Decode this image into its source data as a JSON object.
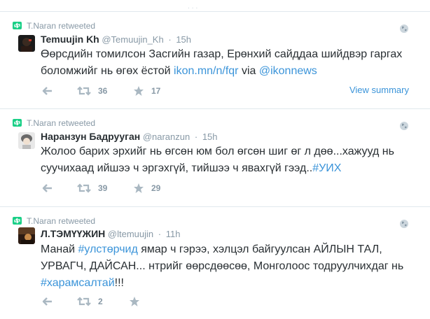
{
  "tweets": [
    {
      "retweeted_by": "T.Naran retweeted",
      "name": "Temuujin Kh",
      "handle": "@Temuujin_Kh",
      "dot": "·",
      "time": "15h",
      "text_parts": [
        "Өөрсдийн томилсон Засгийн газар, Ерөнхий сайддаа шийдвэр гаргах боломжийг нь өгөх ёстой ",
        "ikon.mn/n/fqr",
        " via ",
        "@ikonnews"
      ],
      "retweet_count": "36",
      "favorite_count": "17",
      "view_summary": "View summary",
      "avatar_colors": [
        "#1a1a1a",
        "#3a2a20",
        "#c0392b"
      ]
    },
    {
      "retweeted_by": "T.Naran retweeted",
      "name": "Наранзун Бадрууган",
      "handle": "@naranzun",
      "dot": "·",
      "time": "15h",
      "text_parts": [
        "Жолоо барих эрхийг нь өгсөн юм бол өгсөн шиг өг л дөө...хажууд нь суучихаад ийшээ ч эргэхгүй, тийшээ ч явахгүй гээд..",
        "#УИХ"
      ],
      "retweet_count": "39",
      "favorite_count": "29",
      "avatar_colors": [
        "#d8d8d8",
        "#8a8a8a",
        "#f0e0d0"
      ]
    },
    {
      "retweeted_by": "T.Naran retweeted",
      "name": "Л.ТЭМҮҮЖИН",
      "handle": "@ltemuujin",
      "dot": "·",
      "time": "11h",
      "text_parts": [
        "Манай ",
        "#улстөрчид",
        " ямар ч гэрээ, хэлцэл байгуулсан АЙЛЫН ТАЛ, УРВАГЧ, ДАЙСАН... нтрийг өөрсдөөсөө, Монголоос тодруулчихдаг нь ",
        "#харамсалтай",
        "!!!"
      ],
      "retweet_count": "2",
      "avatar_colors": [
        "#2b1a12",
        "#7a4a2a",
        "#c78a4a"
      ]
    }
  ],
  "colors": {
    "link": "#3b94d9",
    "muted": "#8899a6",
    "retweet_green": "#19cf86",
    "text": "#292f33"
  }
}
